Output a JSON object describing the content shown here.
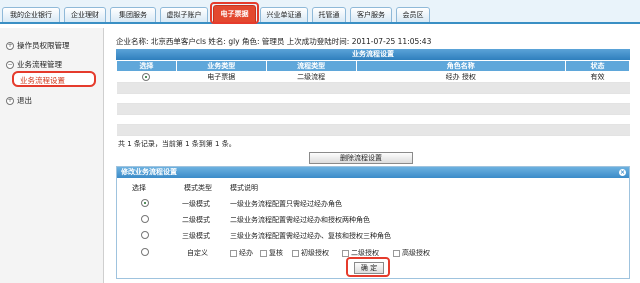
{
  "tabs": [
    {
      "label": "我的企业银行"
    },
    {
      "label": "企业理财"
    },
    {
      "label": "集团服务"
    },
    {
      "label": "虚拟子账户"
    },
    {
      "label": "电子票据"
    },
    {
      "label": "兴业单证通"
    },
    {
      "label": "托管通"
    },
    {
      "label": "客户服务"
    },
    {
      "label": "会员区"
    }
  ],
  "sidebar": {
    "items": [
      {
        "label": "操作员权限管理"
      },
      {
        "label": "业务流程管理"
      },
      {
        "label": "业务流程设置"
      },
      {
        "label": "退出"
      }
    ]
  },
  "info": {
    "text": "企业名称: 北京西单客户cls  姓名: gly  角色: 管理员  上次成功登陆时间: 2011-07-25 11:05:43"
  },
  "grid": {
    "title": "业务流程设置",
    "headers": [
      "选择",
      "业务类型",
      "流程类型",
      "角色名称",
      "状态"
    ],
    "row": {
      "type": "电子票据",
      "flow": "二级流程",
      "roles": "经办  授权",
      "status": "有效"
    }
  },
  "summary": "共 1 条记录，当前第 1 条到第 1 条。",
  "delete_button": "删除流程设置",
  "modify": {
    "title": "修改业务流程设置",
    "headers": {
      "choose": "选择",
      "mode": "模式类型",
      "desc": "模式说明"
    },
    "modes": [
      {
        "mode": "一级模式",
        "desc": "一级业务流程配置只需经过经办角色"
      },
      {
        "mode": "二级模式",
        "desc": "二级业务流程配置需经过经办和授权两种角色"
      },
      {
        "mode": "三级模式",
        "desc": "三级业务流程配置需经过经办、复核和授权三种角色"
      },
      {
        "mode": "自定义",
        "desc": ""
      }
    ],
    "custom_options": [
      "经办",
      "复核",
      "初级授权",
      "二级授权",
      "高级授权"
    ],
    "confirm": "确 定"
  }
}
